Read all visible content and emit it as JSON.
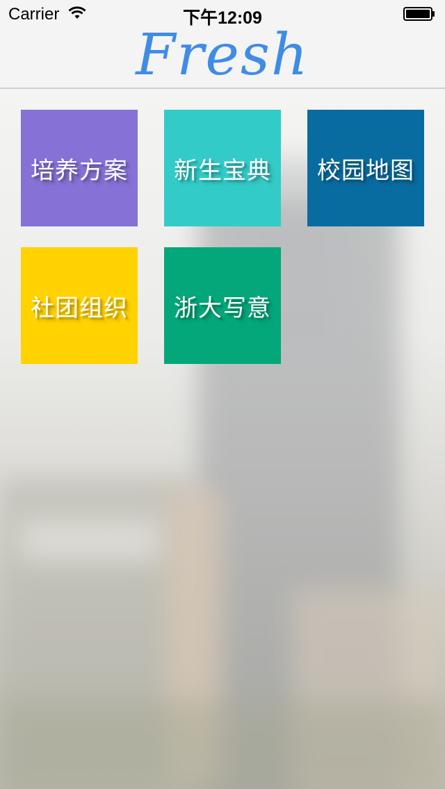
{
  "status_bar": {
    "carrier": "Carrier",
    "time": "下午12:09",
    "wifi_icon": "wifi-icon",
    "battery_icon": "battery-icon"
  },
  "header": {
    "title": "Fresh",
    "title_color": "#3f8ce5"
  },
  "tiles": [
    {
      "label": "培养方案",
      "color": "#8671d6"
    },
    {
      "label": "新生宝典",
      "color": "#33cbc8"
    },
    {
      "label": "校园地图",
      "color": "#096ca1"
    },
    {
      "label": "社团组织",
      "color": "#ffd200"
    },
    {
      "label": "浙大写意",
      "color": "#04a77a"
    }
  ]
}
